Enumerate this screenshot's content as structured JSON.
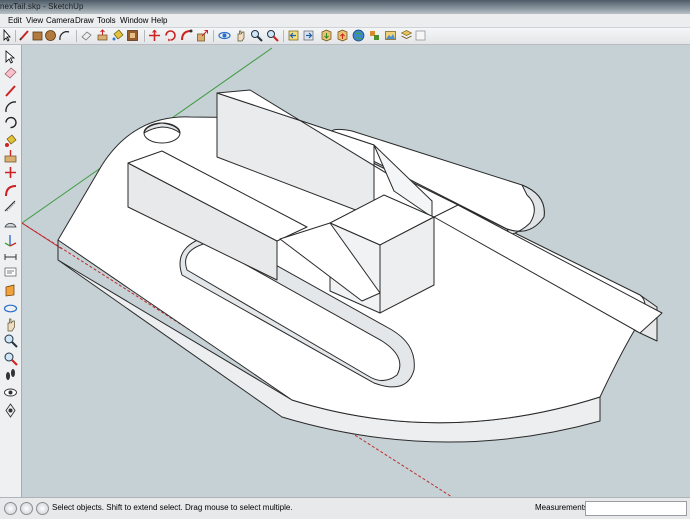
{
  "window": {
    "title": "nexTail.skp - SketchUp"
  },
  "menu": {
    "items": [
      "Edit",
      "View",
      "Camera",
      "Draw",
      "Tools",
      "Window",
      "Help"
    ]
  },
  "toolbar": {
    "icons": [
      "select-arrow-icon",
      "eraser-icon",
      "pencil-line-icon",
      "rectangle-icon",
      "circle-icon",
      "arc-icon",
      "push-pull-icon",
      "paint-bucket-icon",
      "offset-icon",
      "move-icon",
      "rotate-icon",
      "follow-me-icon",
      "scale-icon",
      "orbit-icon",
      "pan-icon",
      "zoom-icon",
      "zoom-extents-icon",
      "previous-view-icon",
      "next-view-icon",
      "get-models-icon",
      "share-model-icon",
      "place-model-icon",
      "components-icon",
      "photo-textures-icon",
      "layers-icon"
    ]
  },
  "left_tools": {
    "icons": [
      "select-icon",
      "eraser-icon",
      "paint-icon",
      "line-icon",
      "rectangle-icon",
      "circle-icon",
      "arc-icon",
      "polygon-icon",
      "freehand-icon",
      "move-icon",
      "push-pull-icon",
      "rotate-icon",
      "follow-me-icon",
      "scale-icon",
      "offset-icon",
      "tape-measure-icon",
      "dimension-icon",
      "protractor-icon",
      "text-icon",
      "axes-icon",
      "3d-text-icon",
      "section-plane-icon",
      "orbit-icon",
      "pan-icon",
      "zoom-icon",
      "zoom-window-icon",
      "zoom-extents-icon",
      "walk-icon",
      "look-around-icon",
      "position-camera-icon"
    ]
  },
  "status": {
    "text": "Select objects. Shift to extend select. Drag mouse to select multiple.",
    "measurements_label": "Measurements",
    "measurements_value": ""
  },
  "colors": {
    "viewport_bg": "#c6d1d6",
    "model_face": "#ffffff",
    "model_side": "#e9eaec",
    "edge": "#2a2a2a",
    "axis_green": "#3e9a3e",
    "axis_red": "#c02a2a"
  }
}
